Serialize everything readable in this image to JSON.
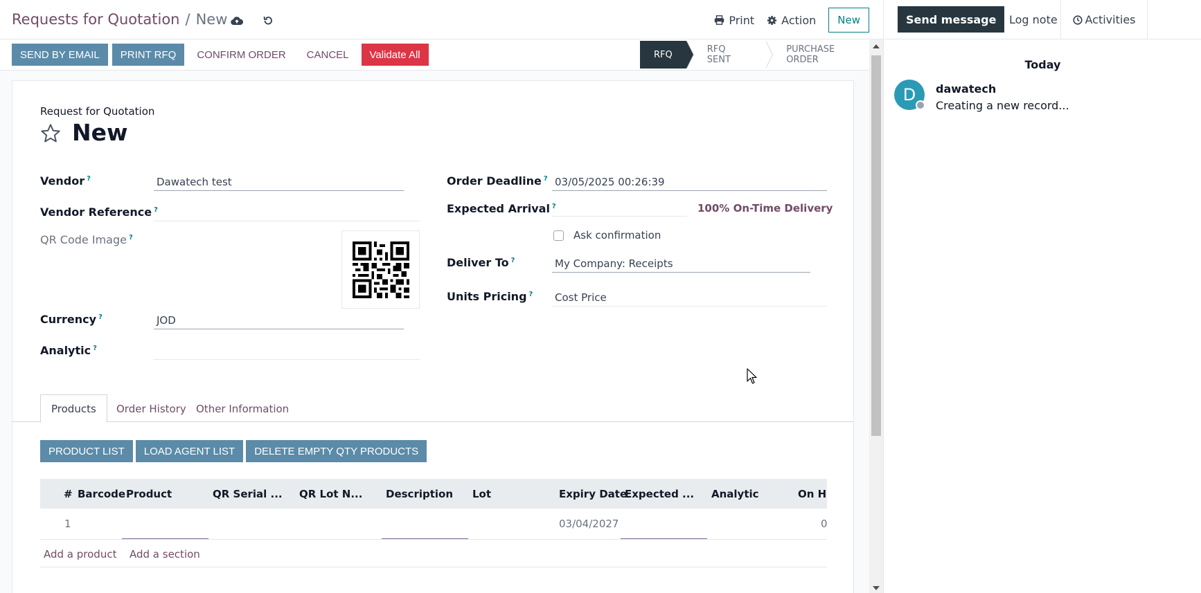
{
  "breadcrumb": {
    "parent": "Requests for Quotation",
    "current": "New"
  },
  "top_actions": {
    "print": "Print",
    "action": "Action",
    "new": "New"
  },
  "control_buttons": {
    "send_email": "SEND BY EMAIL",
    "print_rfq": "PRINT RFQ",
    "confirm": "CONFIRM ORDER",
    "cancel": "CANCEL",
    "validate": "Validate All"
  },
  "status_stages": [
    {
      "label": "RFQ",
      "active": true
    },
    {
      "label": "RFQ SENT",
      "active": false
    },
    {
      "label": "PURCHASE ORDER",
      "active": false
    }
  ],
  "form": {
    "title_label": "Request for Quotation",
    "title": "New",
    "vendor_label": "Vendor",
    "vendor_value": "Dawatech test",
    "vendor_ref_label": "Vendor Reference",
    "vendor_ref_value": "",
    "qr_label": "QR Code Image",
    "currency_label": "Currency",
    "currency_value": "JOD",
    "analytic_label": "Analytic",
    "analytic_value": "",
    "deadline_label": "Order Deadline",
    "deadline_value": "03/05/2025 00:26:39",
    "arrival_label": "Expected Arrival",
    "arrival_value": "",
    "on_time": "100% On-Time Delivery",
    "ask_confirm": "Ask confirmation",
    "deliver_label": "Deliver To",
    "deliver_value": "My Company: Receipts",
    "pricing_label": "Units Pricing",
    "pricing_value": "Cost Price",
    "help_mark": "?"
  },
  "tabs": [
    "Products",
    "Order History",
    "Other Information"
  ],
  "sub_buttons": {
    "product_list": "PRODUCT LIST",
    "load_agent": "LOAD AGENT LIST",
    "delete_empty": "DELETE EMPTY QTY PRODUCTS"
  },
  "table": {
    "columns": [
      "#",
      "Barcode",
      "Product",
      "QR Serial ...",
      "QR Lot N...",
      "Description",
      "Lot",
      "Expiry Date",
      "Expected ...",
      "Analytic",
      "On Ha"
    ],
    "rows": [
      {
        "num": "1",
        "expiry": "03/04/2027",
        "on_hand": "0"
      }
    ],
    "add_product": "Add a product",
    "add_section": "Add a section"
  },
  "chatter": {
    "send_message": "Send message",
    "log_note": "Log note",
    "activities": "Activities",
    "today": "Today",
    "avatar_letter": "D",
    "author": "dawatech",
    "body": "Creating a new record..."
  }
}
